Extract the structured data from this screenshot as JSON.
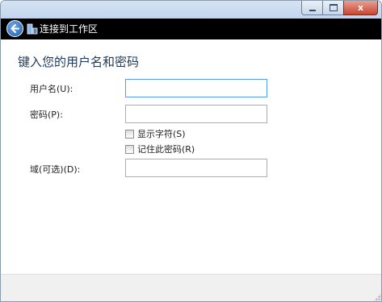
{
  "window": {
    "nav_title": "连接到工作区",
    "caption": {
      "close_symbol": "x"
    }
  },
  "form": {
    "heading": "键入您的用户名和密码",
    "username_label": "用户名(U):",
    "username_value": "",
    "password_label": "密码(P):",
    "password_value": "",
    "show_chars_label": "显示字符(S)",
    "show_chars_checked": false,
    "remember_label": "记住此密码(R)",
    "remember_checked": false,
    "domain_label": "域(可选)(D):",
    "domain_value": ""
  },
  "icons": {
    "back": "back-arrow-icon",
    "app": "workplace-app-icon",
    "minimize": "minimize-icon",
    "maximize": "maximize-icon",
    "close": "close-icon"
  },
  "colors": {
    "nav_background": "#000000",
    "heading_text": "#1e395b",
    "close_button": "#c9452f",
    "focus_border": "#569de5",
    "footer_background": "#f0f0f0"
  }
}
